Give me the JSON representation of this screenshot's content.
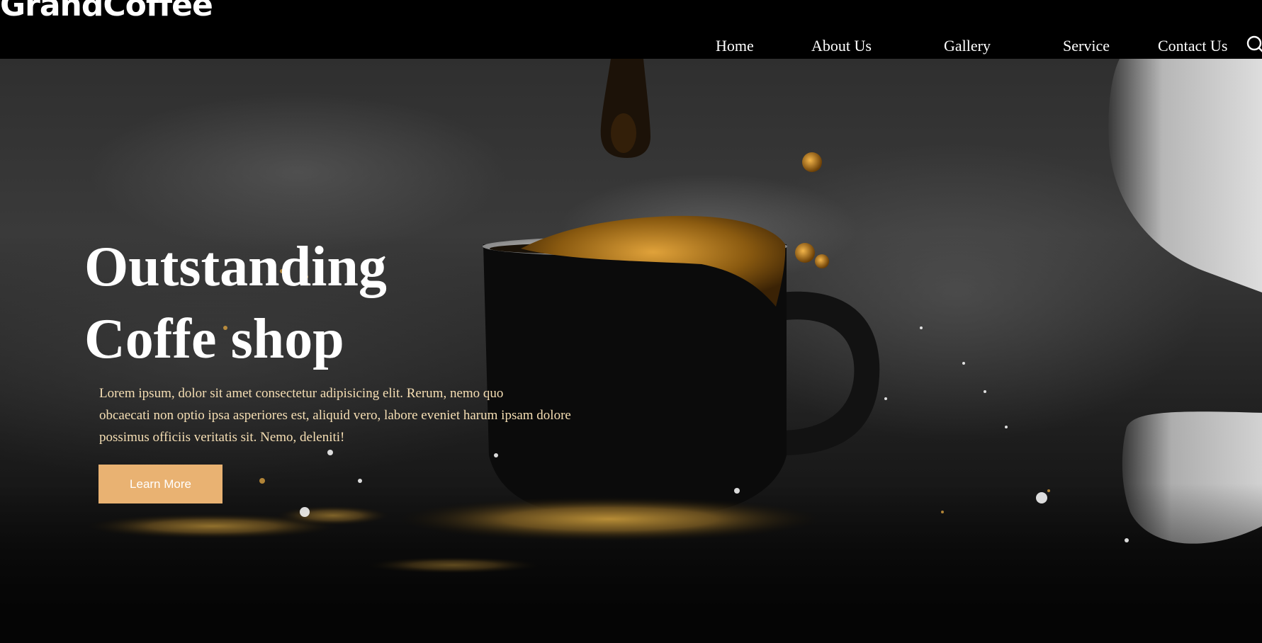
{
  "header": {
    "logo_text": "GrandCoffee",
    "nav": [
      {
        "label": "Home"
      },
      {
        "label": "About Us"
      },
      {
        "label": "Gallery"
      },
      {
        "label": "Service"
      },
      {
        "label": "Contact Us"
      }
    ],
    "search_icon": "search-icon"
  },
  "hero": {
    "title_line1": "Outstanding",
    "title_line2": "Coffe shop",
    "description_line1": "Lorem ipsum, dolor sit amet consectetur adipisicing elit. Rerum, nemo quo",
    "description_line2": "obcaecati non optio ipsa asperiores est, aliquid vero, labore eveniet harum ipsam dolore",
    "description_line3": "possimus officiis veritatis sit. Nemo, deleniti!",
    "button_label": "Learn More",
    "background_image": "coffee-cup-splash-photo"
  },
  "colors": {
    "header_background": "#000000",
    "nav_text": "#ffffff",
    "title_text": "#ffffff",
    "description_text": "#f6dfb4",
    "button_background": "#e9b272",
    "button_text": "#ffffff",
    "coffee_accent": "#b8860b"
  }
}
